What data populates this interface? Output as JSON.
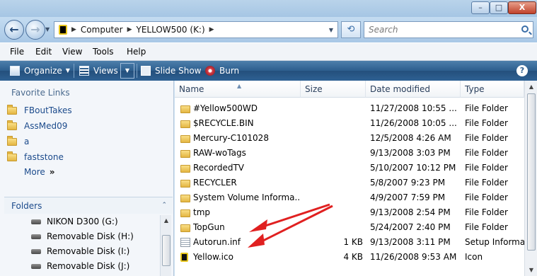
{
  "window": {
    "min_label": "–",
    "max_label": "□",
    "close_label": "X"
  },
  "address": {
    "crumbs": [
      "Computer",
      "YELLOW500 (K:)"
    ],
    "search_placeholder": "Search"
  },
  "menu": [
    "File",
    "Edit",
    "View",
    "Tools",
    "Help"
  ],
  "toolbar": {
    "organize": "Organize",
    "views": "Views",
    "slideshow": "Slide Show",
    "burn": "Burn",
    "help": "?"
  },
  "nav": {
    "favorites_heading": "Favorite Links",
    "favorites": [
      "FBoutTakes",
      "AssMed09",
      "a",
      "faststone"
    ],
    "more": "More",
    "more_arrows": "»",
    "folders_heading": "Folders",
    "folders_caret": "⌃",
    "tree": [
      "NIKON D300 (G:)",
      "Removable Disk (H:)",
      "Removable Disk (I:)",
      "Removable Disk (J:)"
    ]
  },
  "filelist": {
    "columns": [
      "Name",
      "Size",
      "Date modified",
      "Type"
    ],
    "rows": [
      {
        "name": "#Yellow500WD",
        "size": "",
        "date": "11/27/2008 10:55 ...",
        "type": "File Folder",
        "icon": "folder-icon"
      },
      {
        "name": "$RECYCLE.BIN",
        "size": "",
        "date": "11/26/2008 10:05 ...",
        "type": "File Folder",
        "icon": "folder-icon"
      },
      {
        "name": "Mercury-C101028",
        "size": "",
        "date": "12/5/2008 4:26 AM",
        "type": "File Folder",
        "icon": "folder-icon"
      },
      {
        "name": "RAW-woTags",
        "size": "",
        "date": "9/13/2008 3:03 PM",
        "type": "File Folder",
        "icon": "folder-icon"
      },
      {
        "name": "RecordedTV",
        "size": "",
        "date": "5/10/2007 10:12 PM",
        "type": "File Folder",
        "icon": "folder-icon"
      },
      {
        "name": "RECYCLER",
        "size": "",
        "date": "5/8/2007 9:23 PM",
        "type": "File Folder",
        "icon": "folder-icon"
      },
      {
        "name": "System Volume Informa...",
        "size": "",
        "date": "4/9/2007 7:59 PM",
        "type": "File Folder",
        "icon": "folder-icon"
      },
      {
        "name": "tmp",
        "size": "",
        "date": "9/13/2008 2:54 PM",
        "type": "File Folder",
        "icon": "folder-icon"
      },
      {
        "name": "TopGun",
        "size": "",
        "date": "5/24/2007 2:40 PM",
        "type": "File Folder",
        "icon": "folder-icon"
      },
      {
        "name": "Autorun.inf",
        "size": "1 KB",
        "date": "9/13/2008 3:11 PM",
        "type": "Setup Informa...",
        "icon": "setup-file-icon"
      },
      {
        "name": "Yellow.ico",
        "size": "4 KB",
        "date": "11/26/2008 9:53 AM",
        "type": "Icon",
        "icon": "icon-file-icon"
      }
    ]
  },
  "colors": {
    "toolbar": "#2d5e8e",
    "link": "#1c4b8c",
    "annotation_arrow": "#e02020"
  }
}
